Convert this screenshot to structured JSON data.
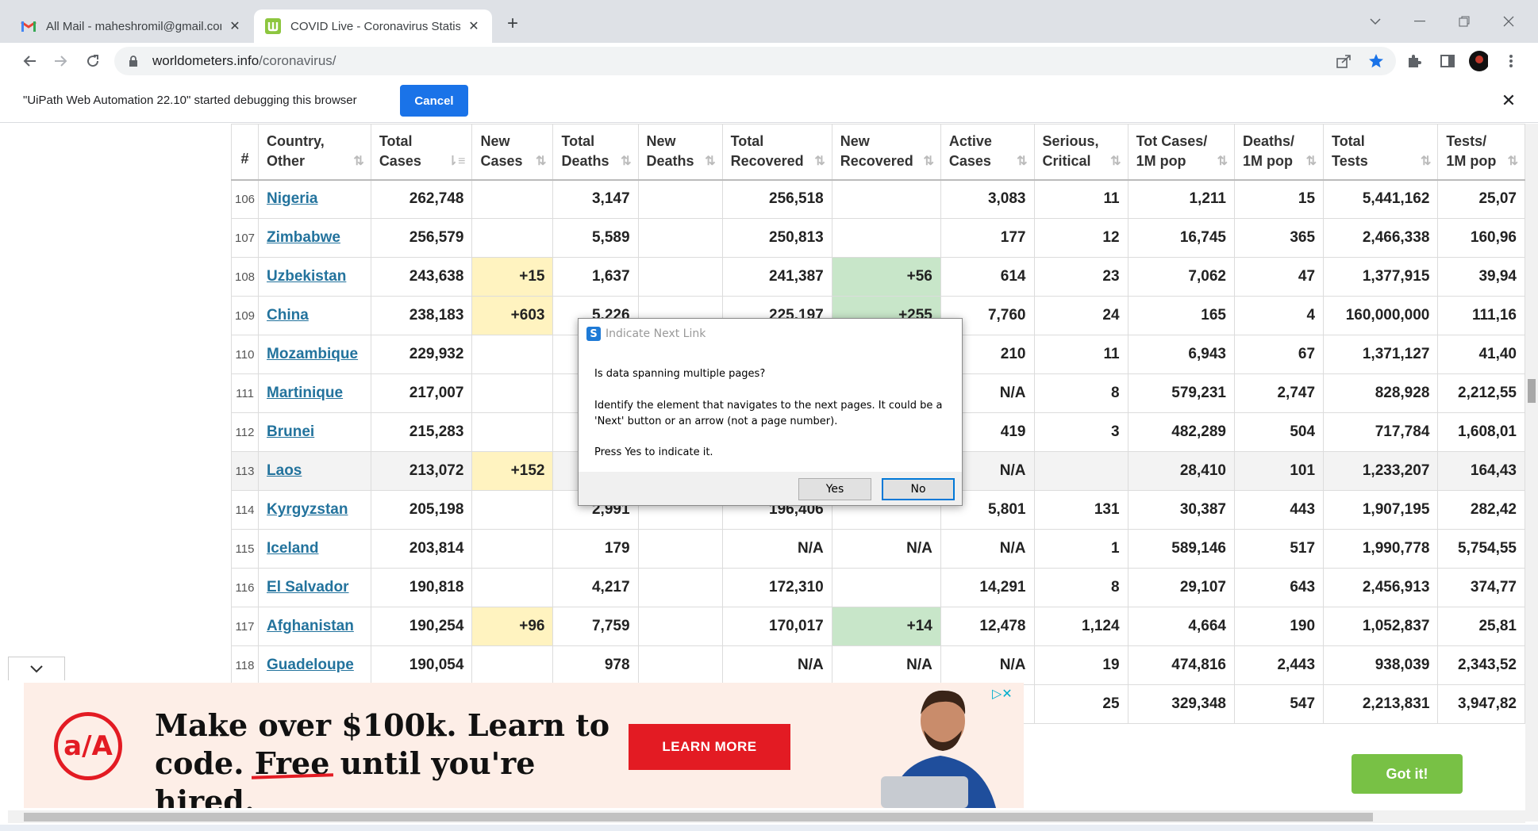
{
  "browser": {
    "tabs": [
      {
        "title": "All Mail - maheshromil@gmail.com",
        "icon": "gmail-icon"
      },
      {
        "title": "COVID Live - Coronavirus Statistics",
        "icon": "worldometer-icon"
      }
    ],
    "address": {
      "host": "worldometers.info",
      "path": "/coronavirus/"
    }
  },
  "infobar": {
    "message": "\"UiPath Web Automation 22.10\" started debugging this browser",
    "cancel_label": "Cancel"
  },
  "table": {
    "headers": [
      {
        "l1": "#",
        "l2": ""
      },
      {
        "l1": "Country,",
        "l2": "Other"
      },
      {
        "l1": "Total",
        "l2": "Cases"
      },
      {
        "l1": "New",
        "l2": "Cases"
      },
      {
        "l1": "Total",
        "l2": "Deaths"
      },
      {
        "l1": "New",
        "l2": "Deaths"
      },
      {
        "l1": "Total",
        "l2": "Recovered"
      },
      {
        "l1": "New",
        "l2": "Recovered"
      },
      {
        "l1": "Active",
        "l2": "Cases"
      },
      {
        "l1": "Serious,",
        "l2": "Critical"
      },
      {
        "l1": "Tot Cases/",
        "l2": "1M pop"
      },
      {
        "l1": "Deaths/",
        "l2": "1M pop"
      },
      {
        "l1": "Total",
        "l2": "Tests"
      },
      {
        "l1": "Tests/",
        "l2": "1M pop"
      }
    ],
    "rows": [
      {
        "n": "106",
        "country": "Nigeria",
        "total_cases": "262,748",
        "new_cases": "",
        "total_deaths": "3,147",
        "new_deaths": "",
        "total_recovered": "256,518",
        "new_recovered": "",
        "active": "3,083",
        "serious": "11",
        "cases_1m": "1,211",
        "deaths_1m": "15",
        "tests": "5,441,162",
        "tests_1m": "25,07"
      },
      {
        "n": "107",
        "country": "Zimbabwe",
        "total_cases": "256,579",
        "new_cases": "",
        "total_deaths": "5,589",
        "new_deaths": "",
        "total_recovered": "250,813",
        "new_recovered": "",
        "active": "177",
        "serious": "12",
        "cases_1m": "16,745",
        "deaths_1m": "365",
        "tests": "2,466,338",
        "tests_1m": "160,96"
      },
      {
        "n": "108",
        "country": "Uzbekistan",
        "total_cases": "243,638",
        "new_cases": "+15",
        "total_deaths": "1,637",
        "new_deaths": "",
        "total_recovered": "241,387",
        "new_recovered": "+56",
        "active": "614",
        "serious": "23",
        "cases_1m": "7,062",
        "deaths_1m": "47",
        "tests": "1,377,915",
        "tests_1m": "39,94"
      },
      {
        "n": "109",
        "country": "China",
        "total_cases": "238,183",
        "new_cases": "+603",
        "total_deaths": "5,226",
        "new_deaths": "",
        "total_recovered": "225,197",
        "new_recovered": "+255",
        "active": "7,760",
        "serious": "24",
        "cases_1m": "165",
        "deaths_1m": "4",
        "tests": "160,000,000",
        "tests_1m": "111,16"
      },
      {
        "n": "110",
        "country": "Mozambique",
        "total_cases": "229,932",
        "new_cases": "",
        "total_deaths": "",
        "new_deaths": "",
        "total_recovered": "",
        "new_recovered": "",
        "active": "210",
        "serious": "11",
        "cases_1m": "6,943",
        "deaths_1m": "67",
        "tests": "1,371,127",
        "tests_1m": "41,40"
      },
      {
        "n": "111",
        "country": "Martinique",
        "total_cases": "217,007",
        "new_cases": "",
        "total_deaths": "",
        "new_deaths": "",
        "total_recovered": "",
        "new_recovered": "",
        "active": "N/A",
        "serious": "8",
        "cases_1m": "579,231",
        "deaths_1m": "2,747",
        "tests": "828,928",
        "tests_1m": "2,212,55"
      },
      {
        "n": "112",
        "country": "Brunei",
        "total_cases": "215,283",
        "new_cases": "",
        "total_deaths": "",
        "new_deaths": "",
        "total_recovered": "",
        "new_recovered": "",
        "active": "419",
        "serious": "3",
        "cases_1m": "482,289",
        "deaths_1m": "504",
        "tests": "717,784",
        "tests_1m": "1,608,01"
      },
      {
        "n": "113",
        "country": "Laos",
        "total_cases": "213,072",
        "new_cases": "+152",
        "total_deaths": "",
        "new_deaths": "",
        "total_recovered": "",
        "new_recovered": "",
        "active": "N/A",
        "serious": "",
        "cases_1m": "28,410",
        "deaths_1m": "101",
        "tests": "1,233,207",
        "tests_1m": "164,43"
      },
      {
        "n": "114",
        "country": "Kyrgyzstan",
        "total_cases": "205,198",
        "new_cases": "",
        "total_deaths": "2,991",
        "new_deaths": "",
        "total_recovered": "196,406",
        "new_recovered": "",
        "active": "5,801",
        "serious": "131",
        "cases_1m": "30,387",
        "deaths_1m": "443",
        "tests": "1,907,195",
        "tests_1m": "282,42"
      },
      {
        "n": "115",
        "country": "Iceland",
        "total_cases": "203,814",
        "new_cases": "",
        "total_deaths": "179",
        "new_deaths": "",
        "total_recovered": "N/A",
        "new_recovered": "N/A",
        "active": "N/A",
        "serious": "1",
        "cases_1m": "589,146",
        "deaths_1m": "517",
        "tests": "1,990,778",
        "tests_1m": "5,754,55"
      },
      {
        "n": "116",
        "country": "El Salvador",
        "total_cases": "190,818",
        "new_cases": "",
        "total_deaths": "4,217",
        "new_deaths": "",
        "total_recovered": "172,310",
        "new_recovered": "",
        "active": "14,291",
        "serious": "8",
        "cases_1m": "29,107",
        "deaths_1m": "643",
        "tests": "2,456,913",
        "tests_1m": "374,77"
      },
      {
        "n": "117",
        "country": "Afghanistan",
        "total_cases": "190,254",
        "new_cases": "+96",
        "total_deaths": "7,759",
        "new_deaths": "",
        "total_recovered": "170,017",
        "new_recovered": "+14",
        "active": "12,478",
        "serious": "1,124",
        "cases_1m": "4,664",
        "deaths_1m": "190",
        "tests": "1,052,837",
        "tests_1m": "25,81"
      },
      {
        "n": "118",
        "country": "Guadeloupe",
        "total_cases": "190,054",
        "new_cases": "",
        "total_deaths": "978",
        "new_deaths": "",
        "total_recovered": "N/A",
        "new_recovered": "N/A",
        "active": "N/A",
        "serious": "19",
        "cases_1m": "474,816",
        "deaths_1m": "2,443",
        "tests": "938,039",
        "tests_1m": "2,343,52"
      },
      {
        "n": "",
        "country": "",
        "total_cases": "",
        "new_cases": "",
        "total_deaths": "",
        "new_deaths": "",
        "total_recovered": "",
        "new_recovered": "",
        "active": "",
        "serious": "25",
        "cases_1m": "329,348",
        "deaths_1m": "547",
        "tests": "2,213,831",
        "tests_1m": "3,947,82"
      }
    ]
  },
  "dialog": {
    "title": "Indicate Next Link",
    "question": "Is data spanning multiple pages?",
    "description": "Identify the element that navigates to the next pages. It could be a 'Next' button or an arrow (not a page number).",
    "instruction": "Press Yes to indicate it.",
    "yes_label": "Yes",
    "no_label": "No"
  },
  "ad": {
    "logo_text": "a/A",
    "headline_1": "Make over $100k. Learn to",
    "headline_2a": "code. ",
    "headline_2b": "Free",
    "headline_2c": " until you're hired.",
    "cta": "LEARN MORE"
  },
  "cookie": {
    "button": "Got it!"
  },
  "colors": {
    "accent": "#1a73e8",
    "new_cases_bg": "#fff3c0",
    "new_recovered_bg": "#c8e6c9",
    "link": "#23739d",
    "ad_red": "#e31b23",
    "got_it": "#78c145"
  }
}
